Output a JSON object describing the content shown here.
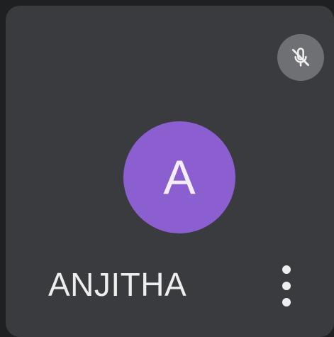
{
  "participant": {
    "initial": "A",
    "name": "ANJITHA",
    "avatar_color": "#8c5fd1",
    "mic_status": "muted",
    "mic_icon": "mic-off-icon",
    "menu_icon": "more-vert-icon"
  }
}
